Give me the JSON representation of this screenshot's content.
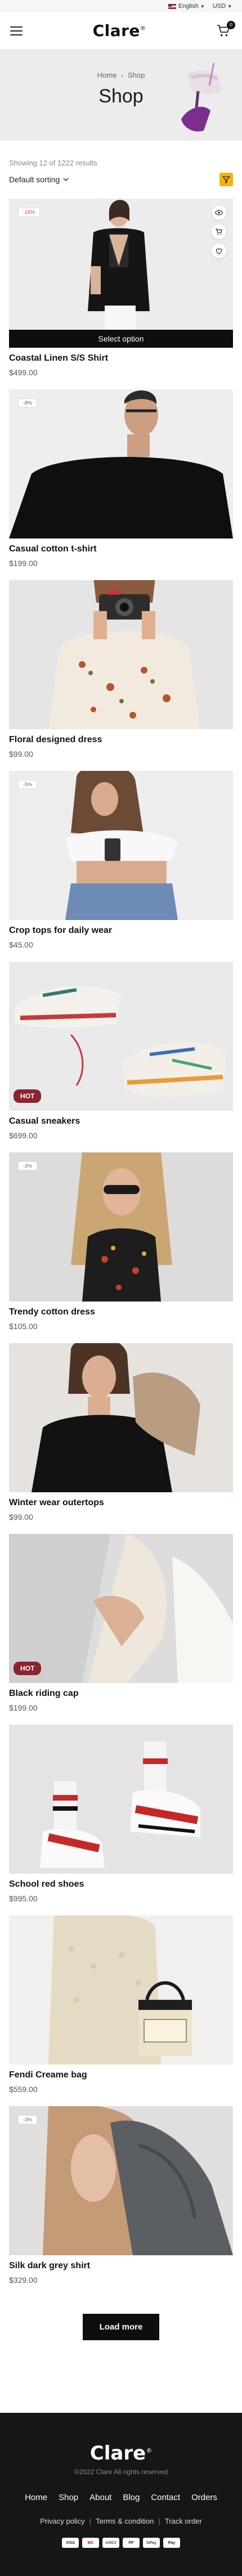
{
  "topbar": {
    "language": "English",
    "currency": "USD"
  },
  "header": {
    "logo": "Clare",
    "logo_mark": "®",
    "cart_count": "0"
  },
  "hero": {
    "crumb_home": "Home",
    "crumb_current": "Shop",
    "title": "Shop"
  },
  "toolbar": {
    "results_text": "Showing 12 of 1222 results",
    "sort_label": "Default sorting"
  },
  "products": [
    {
      "name": "Coastal Linen S/S Shirt",
      "price": "$499.00",
      "badge": "-16%",
      "select_option": "Select option"
    },
    {
      "name": "Casual cotton t-shirt",
      "price": "$199.00",
      "badge": "-8%"
    },
    {
      "name": "Floral designed dress",
      "price": "$99.00"
    },
    {
      "name": "Crop tops for daily wear",
      "price": "$45.00",
      "badge": "-5%"
    },
    {
      "name": "Casual sneakers",
      "price": "$699.00",
      "hot": "HOT"
    },
    {
      "name": "Trendy  cotton dress",
      "price": "$105.00",
      "badge": "-3%"
    },
    {
      "name": "Winter wear outertops",
      "price": "$99.00"
    },
    {
      "name": "Black riding cap",
      "price": "$199.00",
      "hot": "HOT"
    },
    {
      "name": "School red shoes",
      "price": "$995.00"
    },
    {
      "name": "Fendi Creame bag",
      "price": "$559.00"
    },
    {
      "name": "Silk dark grey shirt",
      "price": "$329.00",
      "badge": "-3%"
    }
  ],
  "load_more": "Load more",
  "footer": {
    "logo": "Clare",
    "logo_mark": "®",
    "copyright": "©2022 Clare All rights reserved",
    "nav": [
      "Home",
      "Shop",
      "About",
      "Blog",
      "Contact",
      "Orders"
    ],
    "links": [
      "Privacy policy",
      "Terms & condition",
      "Track order"
    ],
    "payments": [
      "VISA",
      "MC",
      "AMEX",
      "PP",
      "GPay",
      "Pay"
    ]
  },
  "icons": [
    "hamburger-icon",
    "cart-icon",
    "filter-icon",
    "eye-icon",
    "cart-add-icon",
    "heart-icon",
    "chevron-down-icon"
  ]
}
